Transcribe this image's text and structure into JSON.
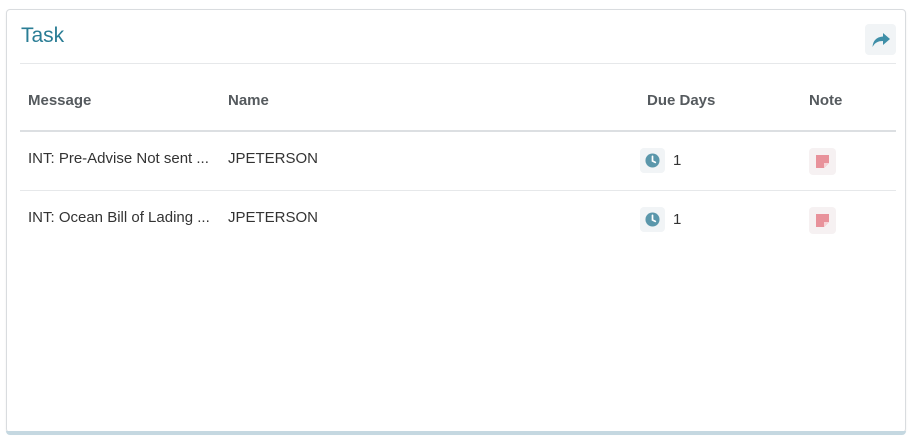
{
  "panel": {
    "title": "Task",
    "share_icon": "share-arrow-icon"
  },
  "table": {
    "columns": {
      "message": "Message",
      "name": "Name",
      "due_days": "Due Days",
      "note": "Note"
    },
    "rows": [
      {
        "message": "INT: Pre-Advise Not sent ...",
        "name": "JPETERSON",
        "due_days": "1",
        "due_icon": "clock-icon",
        "note_icon": "sticky-note-icon"
      },
      {
        "message": "INT: Ocean Bill of Lading ...",
        "name": "JPETERSON",
        "due_days": "1",
        "due_icon": "clock-icon",
        "note_icon": "sticky-note-icon"
      }
    ]
  },
  "colors": {
    "accent": "#2a7d95",
    "clock": "#5b97ab",
    "note": "#e8929b"
  }
}
